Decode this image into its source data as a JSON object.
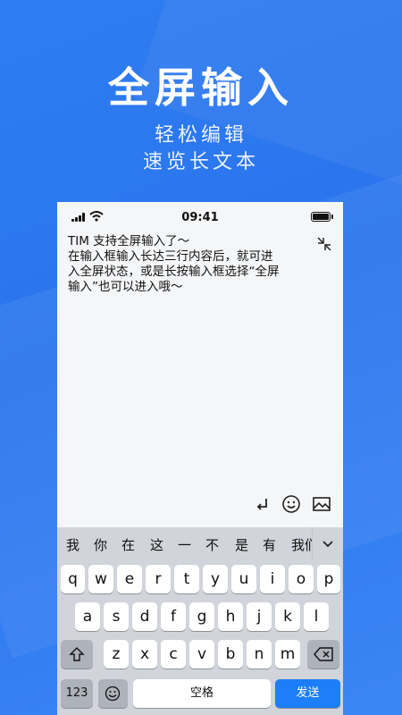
{
  "hero": {
    "title": "全屏输入",
    "subtitle_lines": [
      "轻松编辑",
      "速览长文本"
    ]
  },
  "phone": {
    "status_time": "09:41",
    "message_lines": [
      "TIM 支持全屏输入了～",
      "在输入框输入长达三行内容后，就可进",
      "入全屏状态，或是长按输入框选择“全屏",
      "输入”也可以进入哦～"
    ]
  },
  "candidates": [
    "我",
    "你",
    "在",
    "这",
    "一",
    "不",
    "是",
    "有",
    "我们"
  ],
  "keyboard": {
    "row1": [
      "q",
      "w",
      "e",
      "r",
      "t",
      "y",
      "u",
      "i",
      "o",
      "p"
    ],
    "row2": [
      "a",
      "s",
      "d",
      "f",
      "g",
      "h",
      "j",
      "k",
      "l"
    ],
    "row3": [
      "z",
      "x",
      "c",
      "v",
      "b",
      "n",
      "m"
    ],
    "numbers_label": "123",
    "space_label": "空格",
    "send_label": "发送"
  },
  "icons": [
    "collapse-icon",
    "return-icon",
    "emoji-icon",
    "image-icon",
    "shift-icon",
    "backspace-icon",
    "chevron-down-icon",
    "signal-icon",
    "wifi-icon",
    "battery-icon",
    "emoji-key-icon"
  ],
  "colors": {
    "brand_blue": "#2f7df0",
    "send_blue": "#1c7ef8"
  }
}
